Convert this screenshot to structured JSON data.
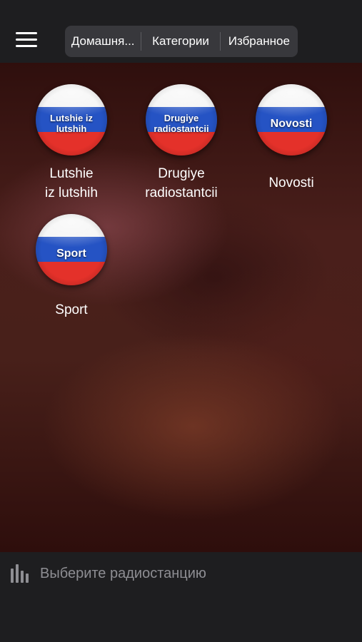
{
  "nav": {
    "tabs": [
      {
        "label": "Домашня..."
      },
      {
        "label": "Категории"
      },
      {
        "label": "Избранное"
      }
    ]
  },
  "stations": [
    {
      "icon_text": "Lutshie iz lutshih",
      "label": "Lutshie\niz lutshih",
      "flag_colors": [
        "#f4f4f4",
        "#2553c4",
        "#e4312a"
      ]
    },
    {
      "icon_text": "Drugiye radiostantcii",
      "label": "Drugiye\nradiostantcii",
      "flag_colors": [
        "#f4f4f4",
        "#2553c4",
        "#e4312a"
      ]
    },
    {
      "icon_text": "Novosti",
      "label": "Novosti",
      "flag_colors": [
        "#f4f4f4",
        "#2553c4",
        "#e4312a"
      ]
    },
    {
      "icon_text": "Sport",
      "label": "Sport",
      "flag_colors": [
        "#f4f4f4",
        "#2553c4",
        "#e4312a"
      ]
    }
  ],
  "player": {
    "icon": "equalizer-icon",
    "status_text": "Выберите радиостанцию"
  },
  "colors": {
    "bar_background": "#1e1e20",
    "segment_background": "#38383c",
    "placeholder_text": "#8e8e93"
  }
}
